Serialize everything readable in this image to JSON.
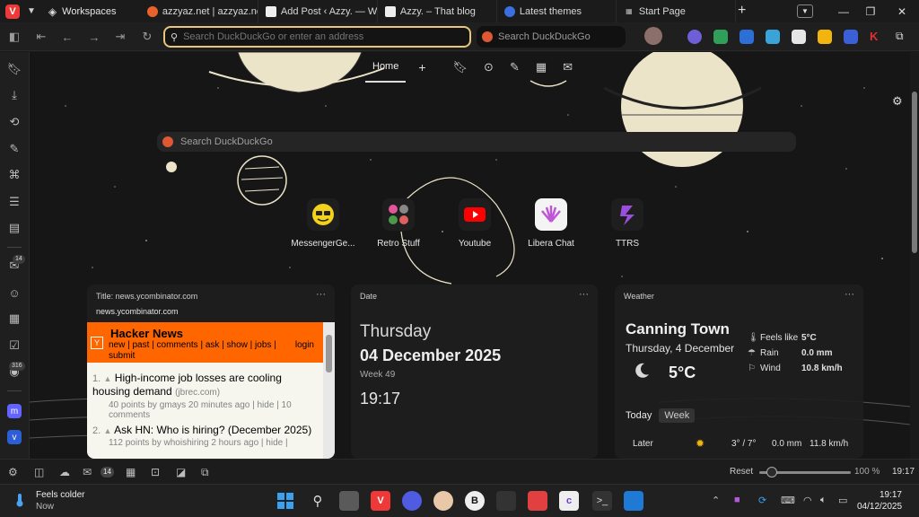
{
  "tabs": {
    "workspaces_label": "Workspaces",
    "items": [
      {
        "label": "azzyaz.net | azzyaz.net | A"
      },
      {
        "label": "Add Post ‹ Azzy. — Word"
      },
      {
        "label": "Azzy. – That blog"
      },
      {
        "label": "Latest themes"
      },
      {
        "label": "Start Page"
      }
    ],
    "new_tab_label": "+"
  },
  "address_bar": {
    "url_placeholder": "Search DuckDuckGo or enter an address",
    "search_placeholder": "Search DuckDuckGo"
  },
  "side_panel": {
    "badges": {
      "mail": "14",
      "feeds": "316"
    }
  },
  "start_page": {
    "tab_home": "Home",
    "tab_add": "+",
    "search_placeholder": "Search DuckDuckGo",
    "speed_dials": [
      {
        "label": "MessengerGe..."
      },
      {
        "label": "Retro Stuff"
      },
      {
        "label": "Youtube"
      },
      {
        "label": "Libera Chat"
      },
      {
        "label": "TTRS"
      }
    ]
  },
  "hn_widget": {
    "title": "Title: news.ycombinator.com",
    "url": "news.ycombinator.com",
    "logo": "Y",
    "site_name": "Hacker News",
    "nav": "new | past | comments | ask | show | jobs | submit",
    "login": "login",
    "items": [
      {
        "num": "1.",
        "title": "High-income job losses are cooling housing demand",
        "site": "(jbrec.com)",
        "sub": "40 points by gmays 20 minutes ago | hide | 10 comments"
      },
      {
        "num": "2.",
        "title": "Ask HN: Who is hiring? (December 2025)",
        "site": "",
        "sub": "112 points by whoishiring 2 hours ago | hide |"
      }
    ]
  },
  "date_widget": {
    "title": "Date",
    "day": "Thursday",
    "date": "04 December 2025",
    "week": "Week 49",
    "time": "19:17"
  },
  "weather_widget": {
    "title": "Weather",
    "city": "Canning Town",
    "date": "Thursday, 4 December",
    "temp": "5°C",
    "feels_like_label": "Feels like",
    "feels_like": "5°C",
    "rain_label": "Rain",
    "rain": "0.0 mm",
    "wind_label": "Wind",
    "wind": "10.8 km/h",
    "tab_today": "Today",
    "tab_week": "Week",
    "later": {
      "label": "Later",
      "range": "3° / 7°",
      "rain": "0.0 mm",
      "wind": "11.8 km/h"
    }
  },
  "status_bar": {
    "mail_badge": "14",
    "reset_label": "Reset",
    "zoom": "100 %",
    "zoom_level": 0.14,
    "time": "19:17"
  },
  "taskbar": {
    "weather_title": "Feels colder",
    "weather_sub": "Now",
    "clock_time": "19:17",
    "clock_date": "04/12/2025"
  },
  "colors": {
    "accent": "#e8c77a",
    "hn_orange": "#ff6600",
    "vivaldi_red": "#ef3939"
  }
}
